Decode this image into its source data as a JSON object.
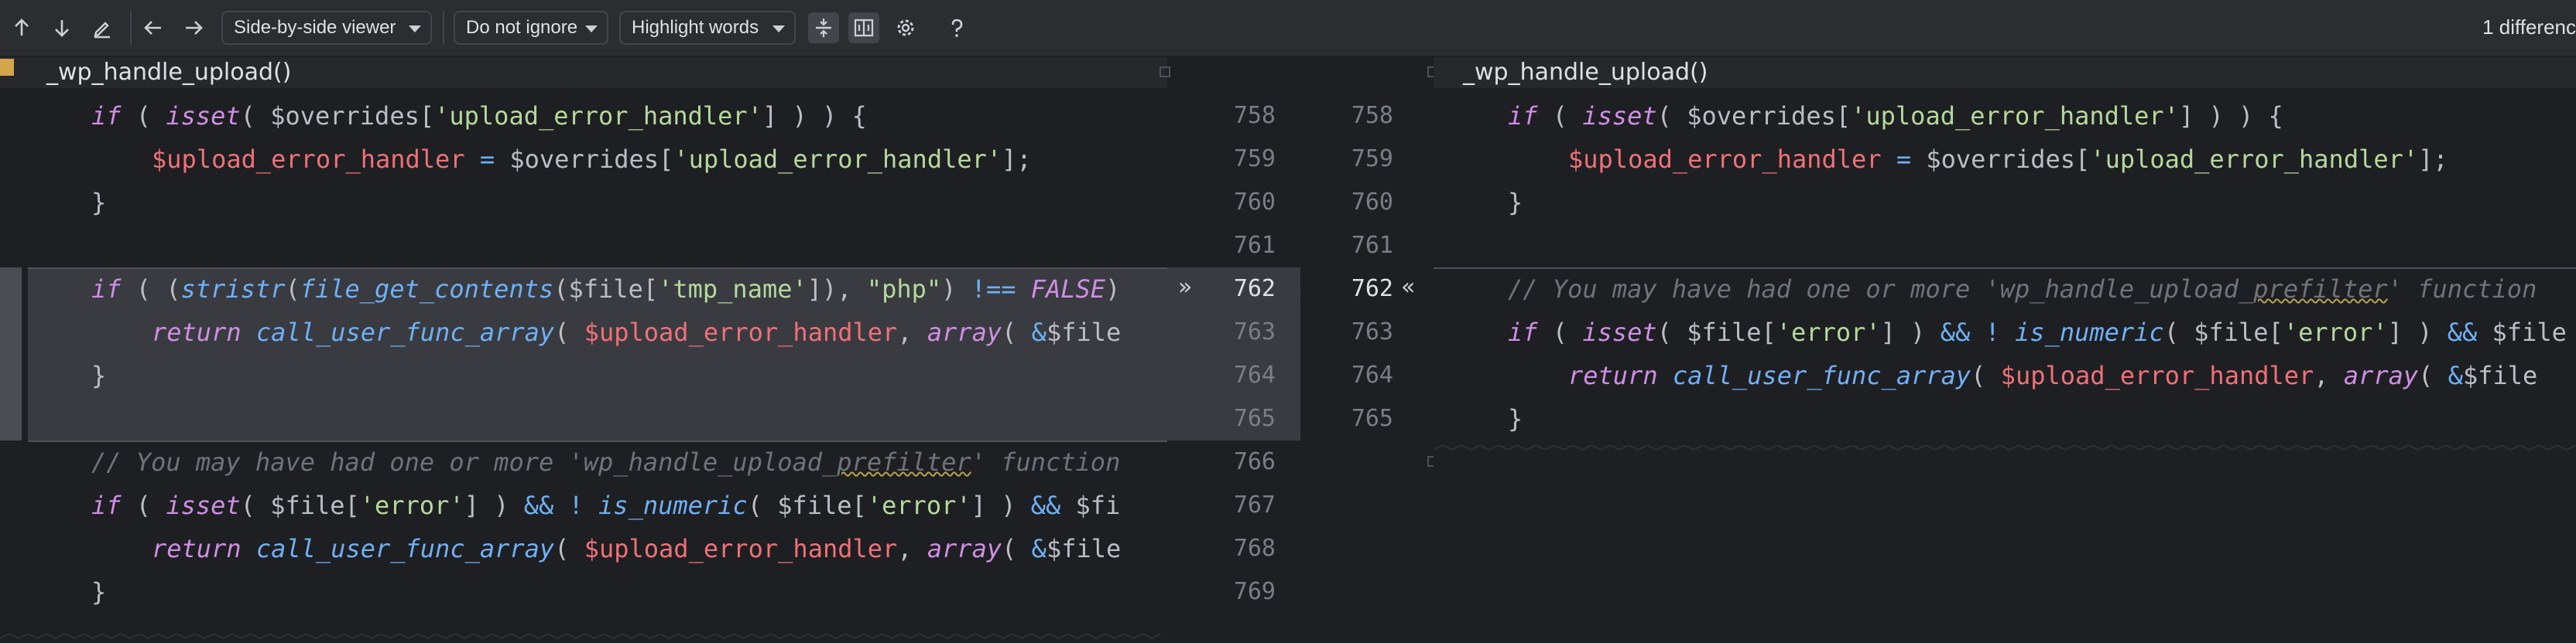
{
  "toolbar": {
    "viewer_label": "Side-by-side viewer",
    "ignore_label": "Do not ignore",
    "highlight_label": "Highlight words",
    "diff_count": "1 differenc"
  },
  "left": {
    "breadcrumb": "_wp_handle_upload()",
    "line_numbers": [
      "758",
      "759",
      "760",
      "761",
      "762",
      "763",
      "764",
      "765",
      "766",
      "767",
      "768",
      "769"
    ]
  },
  "right": {
    "breadcrumb": "_wp_handle_upload()",
    "line_numbers": [
      "758",
      "759",
      "760",
      "761",
      "762",
      "763",
      "764",
      "765"
    ]
  },
  "code": {
    "l1_if": "if",
    "l1_isset": "isset",
    "l1_var": "$overrides",
    "l1_str": "'upload_error_handler'",
    "l2_var": "$upload_error_handler",
    "l2_eq": "=",
    "l2_var2": "$overrides",
    "l2_str": "'upload_error_handler'",
    "brace": "}",
    "lc_if": "if",
    "lc_stristr": "stristr",
    "lc_fgc": "file_get_contents",
    "lc_file": "$file",
    "lc_tmp": "'tmp_name'",
    "lc_php": "\"php\"",
    "lc_neq": "!==",
    "lc_false": "FALSE",
    "ret": "return",
    "cufa": "call_user_func_array",
    "ueh": "$upload_error_handler",
    "arr": "array",
    "amp": "&",
    "file_var": "$file",
    "comment_a": "// You may have had one or more 'wp_handle_upload_",
    "comment_b": "prefilter",
    "comment_c": "' function",
    "err_isset": "isset",
    "err_str": "'error'",
    "and_op": "&&",
    "not_op": "!",
    "is_numeric": "is_numeric",
    "fi_trunc": "$fi"
  }
}
